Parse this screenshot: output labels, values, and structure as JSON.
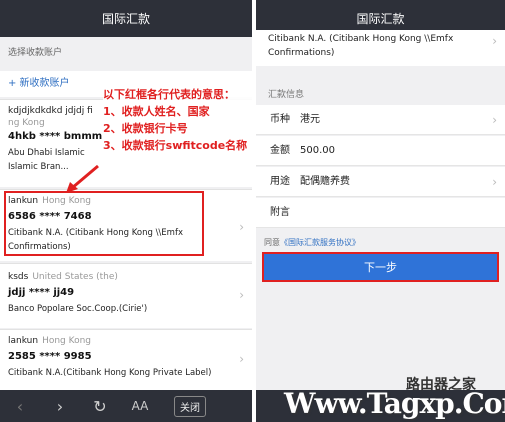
{
  "left": {
    "title": "国际汇款",
    "section_label": "选择收款账户",
    "new_account": "+ 新收款账户",
    "annotation": [
      "以下红框各行代表的意思：",
      "1、收款人姓名、国家",
      "2、收款银行卡号",
      "3、收款银行swfitcode名称"
    ],
    "accounts": [
      {
        "name": "kdjdjkdkdkd jdjdj fi",
        "country": "ng Kong",
        "card": "4hkb **** bmmm",
        "bank1": "Abu Dhabi Islamic",
        "bank2": "Islamic Bran..."
      },
      {
        "name": "lankun",
        "country": "Hong Kong",
        "card": "6586 **** 7468",
        "bank1": "Citibank N.A. (Citibank Hong Kong \\\\Emfx",
        "bank2": "Confirmations)"
      },
      {
        "name": "ksds",
        "country": "United States (the)",
        "card": "jdjj **** jj49",
        "bank1": "Banco Popolare Soc.Coop.(Cirie')",
        "bank2": ""
      },
      {
        "name": "lankun",
        "country": "Hong Kong",
        "card": "2585 **** 9985",
        "bank1": "Citibank N.A.(Citibank Hong Kong Private Label)",
        "bank2": ""
      }
    ],
    "bottombar": {
      "back": "‹",
      "forward": "›",
      "refresh": "↻",
      "font": "AA",
      "close": "关闭"
    }
  },
  "right": {
    "title": "国际汇款",
    "bank_line1": "Citibank N.A. (Citibank Hong Kong \\\\Emfx",
    "bank_line2": "Confirmations)",
    "info_label": "汇款信息",
    "rows": [
      {
        "label": "币种",
        "value": "港元"
      },
      {
        "label": "金额",
        "value": "500.00"
      },
      {
        "label": "用途",
        "value": "配偶赡养费"
      },
      {
        "label": "附言",
        "value": ""
      }
    ],
    "agree_prefix": "同意",
    "agree_link": "《国际汇款服务协议》",
    "next_button": "下一步",
    "watermark": "Www.Tagxp.Com",
    "watermark_cn": "路由器之家"
  },
  "colors": {
    "nav": "#2d3039",
    "accent": "#2f73d8",
    "annotation": "#e02020"
  }
}
